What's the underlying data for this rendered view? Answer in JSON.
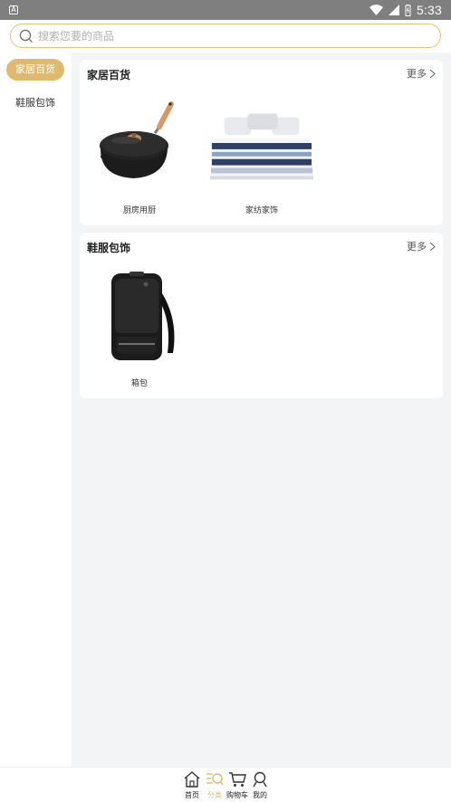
{
  "status_bar": {
    "time": "5:33",
    "app_badge": "A"
  },
  "search": {
    "placeholder": "搜索您要的商品"
  },
  "sidebar": {
    "items": [
      {
        "label": "家居百货",
        "active": true
      },
      {
        "label": "鞋服包饰",
        "active": false
      }
    ]
  },
  "sections": [
    {
      "title": "家居百货",
      "more": "更多",
      "products": [
        {
          "name": "厨房用厨",
          "image": "wok-pan-icon"
        },
        {
          "name": "家纺家饰",
          "image": "bedding-icon"
        }
      ]
    },
    {
      "title": "鞋服包饰",
      "more": "更多",
      "products": [
        {
          "name": "箱包",
          "image": "backpack-icon"
        }
      ]
    }
  ],
  "bottom_nav": {
    "items": [
      {
        "label": "首页",
        "icon": "home-icon",
        "active": false
      },
      {
        "label": "分类",
        "icon": "category-icon",
        "active": true
      },
      {
        "label": "购物车",
        "icon": "cart-icon",
        "active": false
      },
      {
        "label": "我的",
        "icon": "profile-icon",
        "active": false
      }
    ]
  },
  "colors": {
    "accent": "#dfb96d",
    "background": "#f3f4f6"
  }
}
